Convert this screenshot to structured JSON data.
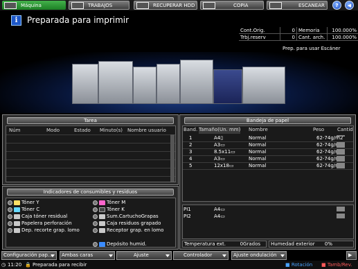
{
  "tabs": [
    {
      "label": "Máquina",
      "active": true
    },
    {
      "label": "TRABAJOS"
    },
    {
      "label": "RECUPERAR HDD"
    },
    {
      "label": "COPIA"
    },
    {
      "label": "ESCANEAR"
    }
  ],
  "status": {
    "message": "Preparada para imprimir",
    "scanner": "Prep. para usar Escáner"
  },
  "counters": {
    "cont_orig_label": "Cont.Orig.",
    "cont_orig_value": "0",
    "memoria_label": "Memoria",
    "memoria_value": "100.000%",
    "trbj_reserv_label": "Trbj.reserv",
    "trbj_reserv_value": "0",
    "cant_arch_label": "Cant. arch.",
    "cant_arch_value": "100.000%"
  },
  "tarea": {
    "title": "Tarea",
    "columns": [
      "Núm",
      "Modo",
      "Estado",
      "Minuto(s)",
      "Nombre usuario"
    ]
  },
  "bandeja": {
    "title": "Bandeja de papel",
    "columns": [
      "Band.",
      "Tamaño(Un. mm)",
      "Nombre",
      "Peso",
      "Cantid"
    ],
    "rows": [
      {
        "band": "1",
        "size": "A4▯",
        "name": "Normal",
        "weight": "62-74g/m2",
        "fill": 0.3
      },
      {
        "band": "2",
        "size": "A3▭",
        "name": "Normal",
        "weight": "62-74g/m2",
        "fill": 1.0
      },
      {
        "band": "3",
        "size": "8.5x11▭",
        "name": "Normal",
        "weight": "62-74g/m2",
        "fill": 1.0
      },
      {
        "band": "4",
        "size": "A3▭",
        "name": "Normal",
        "weight": "62-74g/m2",
        "fill": 1.0
      },
      {
        "band": "5",
        "size": "12x18▭",
        "name": "Normal",
        "weight": "62-74g/m2",
        "fill": 1.0
      }
    ],
    "pi_rows": [
      {
        "band": "PI1",
        "size": "A4▭"
      },
      {
        "band": "PI2",
        "size": "A4▭"
      }
    ],
    "temp_label": "Temperatura ext.",
    "temp_value": "0Grados",
    "hum_label": "Humedad exterior",
    "hum_value": "0%"
  },
  "consumibles": {
    "title": "Indicadores de consumibles y residuos",
    "left": [
      "Tóner Y",
      "Tóner C",
      "Caja tóner residual",
      "Papelera perforación",
      "Dep. recorte grap. lomo"
    ],
    "right": [
      "Tóner M",
      "Tóner K",
      "Sum.CartuchoGrapas",
      "Caja residuos grapado",
      "Receptor grap. en lomo"
    ],
    "bottom": "Depósito humid."
  },
  "bottom_buttons": [
    "Configuración pap...",
    "Ambas caras",
    "Ajuste",
    "Controlador",
    "Ajuste ondulación"
  ],
  "footer": {
    "time": "11:20",
    "status": "Preparada para recibir",
    "rotacion": "Rotación",
    "tamb": "Tamb/Rev."
  },
  "colors": {
    "accent_green": "#2a9a33",
    "info_blue": "#1d57c8"
  }
}
